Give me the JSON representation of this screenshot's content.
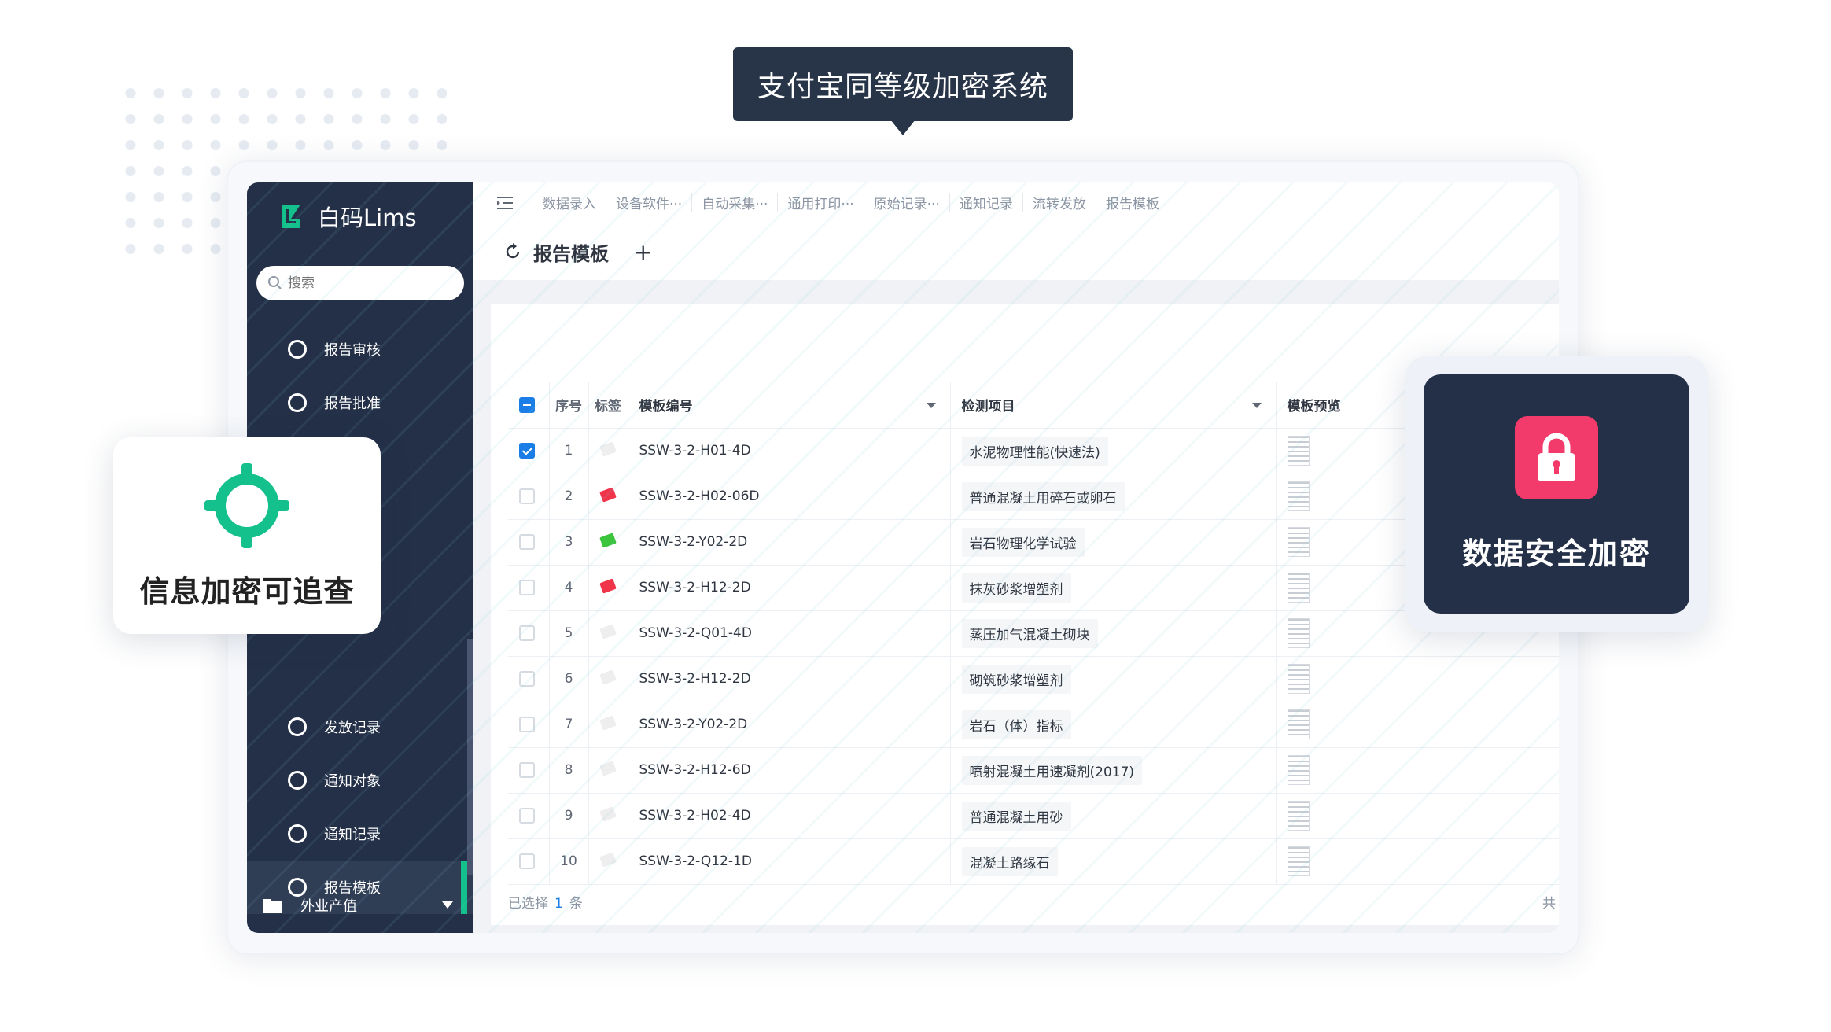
{
  "callout": {
    "text": "支付宝同等级加密系统"
  },
  "brand": {
    "name": "白码Lims",
    "accent": "#14c08b"
  },
  "sidebar": {
    "search_placeholder": "搜索",
    "items": [
      {
        "label": "报告审核"
      },
      {
        "label": "报告批准"
      },
      {
        "label": "发放记录"
      },
      {
        "label": "通知对象"
      },
      {
        "label": "通知记录"
      },
      {
        "label": "报告模板",
        "active": true
      }
    ],
    "group": {
      "label": "外业产值"
    }
  },
  "tabs": [
    "数据录入",
    "设备软件···",
    "自动采集···",
    "通用打印···",
    "原始记录···",
    "通知记录",
    "流转发放",
    "报告模板"
  ],
  "page": {
    "title": "报告模板",
    "add_label": "+"
  },
  "table": {
    "headers": {
      "index": "序号",
      "tag": "标签",
      "code": "模板编号",
      "item": "检测项目",
      "preview": "模板预览"
    },
    "rows": [
      {
        "index": "1",
        "code": "SSW-3-2-H01-4D",
        "item": "水泥物理性能(快速法)",
        "tag_color": "#eeeeee",
        "checked": true
      },
      {
        "index": "2",
        "code": "SSW-3-2-H02-06D",
        "item": "普通混凝土用碎石或卵石",
        "tag_color": "#f0344a",
        "checked": false
      },
      {
        "index": "3",
        "code": "SSW-3-2-Y02-2D",
        "item": "岩石物理化学试验",
        "tag_color": "#3cc43c",
        "checked": false
      },
      {
        "index": "4",
        "code": "SSW-3-2-H12-2D",
        "item": "抹灰砂浆增塑剂",
        "tag_color": "#f0344a",
        "checked": false
      },
      {
        "index": "5",
        "code": "SSW-3-2-Q01-4D",
        "item": "蒸压加气混凝土砌块",
        "tag_color": "#eeeeee",
        "checked": false
      },
      {
        "index": "6",
        "code": "SSW-3-2-H12-2D",
        "item": "砌筑砂浆增塑剂",
        "tag_color": "#eeeeee",
        "checked": false
      },
      {
        "index": "7",
        "code": "SSW-3-2-Y02-2D",
        "item": "岩石（体）指标",
        "tag_color": "#eeeeee",
        "checked": false
      },
      {
        "index": "8",
        "code": "SSW-3-2-H12-6D",
        "item": "喷射混凝土用速凝剂(2017)",
        "tag_color": "#eeeeee",
        "checked": false
      },
      {
        "index": "9",
        "code": "SSW-3-2-H02-4D",
        "item": "普通混凝土用砂",
        "tag_color": "#eeeeee",
        "checked": false
      },
      {
        "index": "10",
        "code": "SSW-3-2-Q12-1D",
        "item": "混凝土路缘石",
        "tag_color": "#eeeeee",
        "checked": false
      }
    ]
  },
  "footer": {
    "selected_prefix": "已选择",
    "selected_count": "1",
    "selected_suffix": "条",
    "total_prefix": "共"
  },
  "cards": {
    "left": {
      "text": "信息加密可追查",
      "icon": "crosshair-icon",
      "color": "#14c08b"
    },
    "right": {
      "text": "数据安全加密",
      "icon": "lock-icon",
      "color": "#f23b6b"
    }
  }
}
